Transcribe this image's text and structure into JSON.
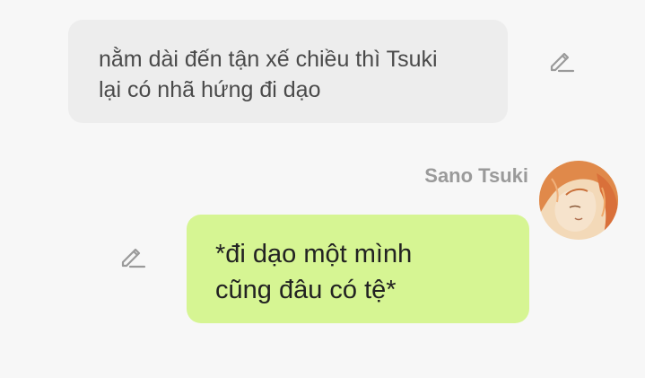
{
  "messages": [
    {
      "side": "left",
      "text": "nằm dài đến tận xế chiều thì Tsuki\nlại có nhã hứng đi dạo",
      "background": "#ededed",
      "action_icon": "edit-pencil-icon"
    },
    {
      "side": "right",
      "sender": "Sano Tsuki",
      "text": "*đi dạo một mình\ncũng đâu có tệ*",
      "background": "#d6f593",
      "action_icon": "edit-pencil-icon",
      "avatar": "character-portrait-avatar"
    }
  ],
  "colors": {
    "page_background": "#f7f7f7",
    "sender_name": "#9a9a9a",
    "icon": "#9a9a9a",
    "avatar_hair": "#e0894a"
  }
}
